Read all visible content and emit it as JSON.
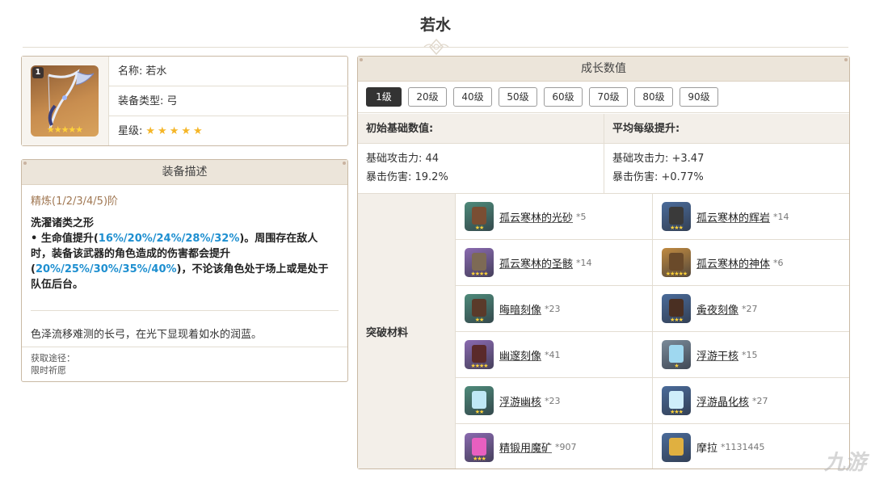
{
  "page_title": "若水",
  "info": {
    "rank": "1",
    "card_stars": "★★★★★",
    "name_label": "名称:",
    "name_value": "若水",
    "type_label": "装备类型:",
    "type_value": "弓",
    "star_label": "星级:",
    "star_value": "★★★★★"
  },
  "description": {
    "header": "装备描述",
    "refine": "精炼(1/2/3/4/5)阶",
    "passive_name": "洗濯诸类之形",
    "passive_a": "• 生命值提升(",
    "passive_hl1": "16%/20%/24%/28%/32%",
    "passive_b": ")。周围存在敌人时，装备该武器的角色造成的伤害都会提升(",
    "passive_hl2": "20%/25%/30%/35%/40%",
    "passive_c": ")，不论该角色处于场上或是处于队伍后台。",
    "flavor": "色泽流移难测的长弓，在光下显现着如水的润蓝。",
    "source_label": "获取途径：",
    "source_value": "限时祈愿"
  },
  "growth": {
    "header": "成长数值",
    "levels": [
      "1级",
      "20级",
      "40级",
      "50级",
      "60级",
      "70级",
      "80级",
      "90级"
    ],
    "active_level": "1级",
    "base_head": "初始基础数值:",
    "avg_head": "平均每级提升:",
    "base_atk": "基础攻击力: 44",
    "base_crit": "暴击伤害: 19.2%",
    "avg_atk": "基础攻击力: +3.47",
    "avg_crit": "暴击伤害: +0.77%",
    "materials_label": "突破材料",
    "materials": [
      {
        "name": "孤云寒林的光砂",
        "count": "*5",
        "color": "#4e8a7a",
        "inner": "#7a4e33",
        "stars": "★★"
      },
      {
        "name": "孤云寒林的辉岩",
        "count": "*14",
        "color": "#4a6b9a",
        "inner": "#3a3a3a",
        "stars": "★★★"
      },
      {
        "name": "孤云寒林的圣骸",
        "count": "*14",
        "color": "#8a6ab0",
        "inner": "#7d6a55",
        "stars": "★★★★"
      },
      {
        "name": "孤云寒林的神体",
        "count": "*6",
        "color": "#c08a40",
        "inner": "#6a4a2a",
        "stars": "★★★★★"
      },
      {
        "name": "晦暗刻像",
        "count": "*23",
        "color": "#4e8a7a",
        "inner": "#5a3a2a",
        "stars": "★★"
      },
      {
        "name": "夤夜刻像",
        "count": "*27",
        "color": "#4a6b9a",
        "inner": "#4a2f22",
        "stars": "★★★"
      },
      {
        "name": "幽邃刻像",
        "count": "*41",
        "color": "#8a6ab0",
        "inner": "#5a2a2a",
        "stars": "★★★★"
      },
      {
        "name": "浮游干核",
        "count": "*15",
        "color": "#7a8a99",
        "inner": "#9fd8f0",
        "stars": "★"
      },
      {
        "name": "浮游幽核",
        "count": "*23",
        "color": "#4e8a7a",
        "inner": "#bfe8f5",
        "stars": "★★"
      },
      {
        "name": "浮游晶化核",
        "count": "*27",
        "color": "#4a6b9a",
        "inner": "#cfeefa",
        "stars": "★★★"
      },
      {
        "name": "精锻用魔矿",
        "count": "*907",
        "color": "#8a6ab0",
        "inner": "#e85fc0",
        "stars": "★★★"
      },
      {
        "name": "摩拉",
        "count": "*1131445",
        "color": "#4a6b9a",
        "inner": "#e0b040",
        "stars": ""
      }
    ]
  },
  "watermark": "九游"
}
